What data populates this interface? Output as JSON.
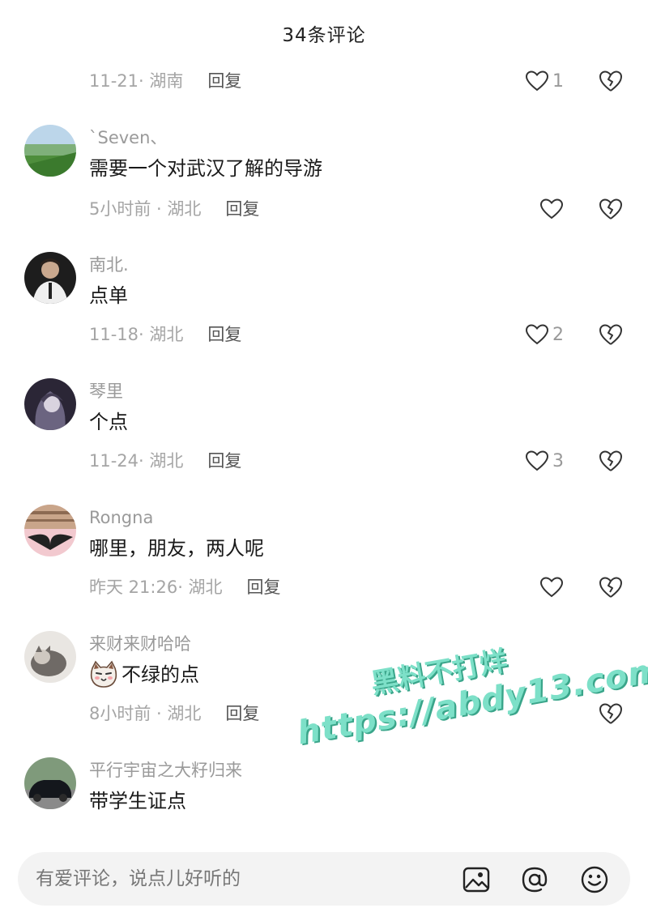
{
  "header": {
    "title": "34条评论"
  },
  "first": {
    "meta": "11-21· 湖南",
    "reply": "回复",
    "likes": "1"
  },
  "comments": [
    {
      "user": "`Seven、",
      "text": "需要一个对武汉了解的导游",
      "meta": "5小时前 · 湖北",
      "reply": "回复",
      "likes": ""
    },
    {
      "user": "南北.",
      "text": "点单",
      "meta": "11-18· 湖北",
      "reply": "回复",
      "likes": "2"
    },
    {
      "user": "琴里",
      "text": "个点",
      "meta": "11-24· 湖北",
      "reply": "回复",
      "likes": "3"
    },
    {
      "user": "Rongna",
      "text": "哪里，朋友，两人呢",
      "meta": "昨天 21:26· 湖北",
      "reply": "回复",
      "likes": ""
    },
    {
      "user": "来财来财哈哈",
      "text": "不绿的点",
      "meta": "8小时前 · 湖北",
      "reply": "回复",
      "likes": ""
    },
    {
      "user": "平行宇宙之大籽归来",
      "text": "带学生证点",
      "meta": "",
      "reply": "",
      "likes": ""
    }
  ],
  "watermark": {
    "line1": "黑料不打烊",
    "line2": "https://abdy13.com"
  },
  "input": {
    "placeholder": "有爱评论，说点儿好听的"
  },
  "icons": [
    "heart-icon",
    "broken-heart-icon",
    "image-icon",
    "at-icon",
    "emoji-icon"
  ],
  "colors": {
    "accent_watermark": "#7de0c8",
    "meta_text": "#a5a5a5"
  }
}
